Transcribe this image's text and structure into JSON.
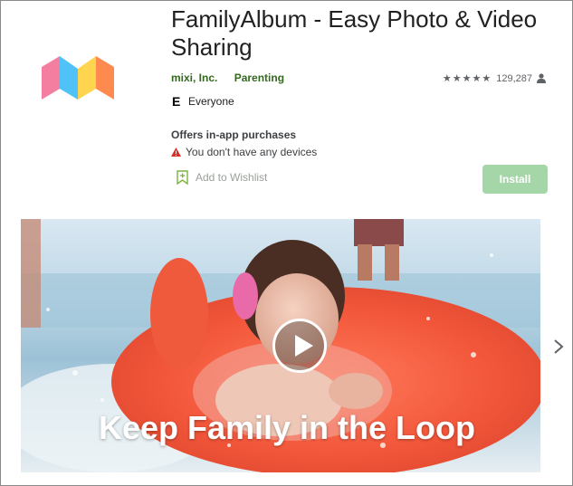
{
  "app": {
    "title": "FamilyAlbum - Easy Photo & Video Sharing",
    "developer": "mixi, Inc.",
    "category": "Parenting",
    "rating_stars": "★★★★★",
    "rating_count": "129,287",
    "content_rating": "Everyone",
    "offers": "Offers in-app purchases",
    "device_warning": "You don't have any devices",
    "wishlist_label": "Add to Wishlist",
    "install_label": "Install"
  },
  "media": {
    "tagline": "Keep Family in the Loop"
  },
  "icons": {
    "logo": "familyalbum-logo",
    "person": "person-icon",
    "esrb": "esrb-e-icon",
    "warning": "warning-icon",
    "bookmark": "bookmark-add-icon",
    "play": "play-icon",
    "next": "chevron-right-icon"
  },
  "colors": {
    "developer_link": "#33691e",
    "install_bg": "#a5d6a7",
    "warning_red": "#d93025"
  }
}
